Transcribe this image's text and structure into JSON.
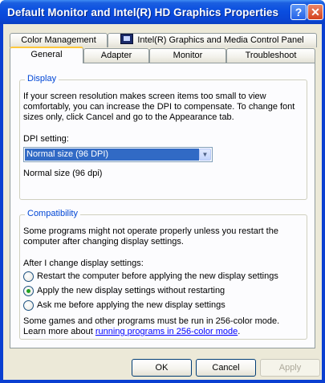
{
  "window": {
    "title": "Default Monitor and Intel(R) HD Graphics Properties",
    "help_glyph": "?",
    "close_glyph": "✕"
  },
  "tabs": {
    "row1": [
      {
        "label": "Color Management"
      },
      {
        "label": "Intel(R) Graphics and Media Control Panel",
        "icon": "display-adapter-icon"
      }
    ],
    "row2": [
      {
        "label": "General",
        "active": true
      },
      {
        "label": "Adapter"
      },
      {
        "label": "Monitor"
      },
      {
        "label": "Troubleshoot"
      }
    ]
  },
  "display": {
    "group_label": "Display",
    "description": "If your screen resolution makes screen items too small to view comfortably, you can increase the DPI to compensate.  To change font sizes only, click Cancel and go to the Appearance tab.",
    "dpi_label": "DPI setting:",
    "dpi_selected": "Normal size (96 DPI)",
    "dpi_current": "Normal size (96 dpi)"
  },
  "compatibility": {
    "group_label": "Compatibility",
    "description": "Some programs might not operate properly unless you restart the computer after changing display settings.",
    "after_label": "After I change display settings:",
    "options": [
      {
        "label": "Restart the computer before applying the new display settings",
        "checked": false
      },
      {
        "label": "Apply the new display settings without restarting",
        "checked": true
      },
      {
        "label": "Ask me before applying the new display settings",
        "checked": false
      }
    ],
    "note_line1": "Some games and other programs must be run in 256-color mode.",
    "note_prefix": "Learn more about ",
    "note_link": "running programs in 256-color mode",
    "note_suffix": "."
  },
  "buttons": {
    "ok": "OK",
    "cancel": "Cancel",
    "apply": "Apply"
  },
  "colors": {
    "titlebar": "#0a4ee0",
    "group_label": "#0046d5",
    "selection": "#316ac5",
    "face": "#ece9d8"
  }
}
